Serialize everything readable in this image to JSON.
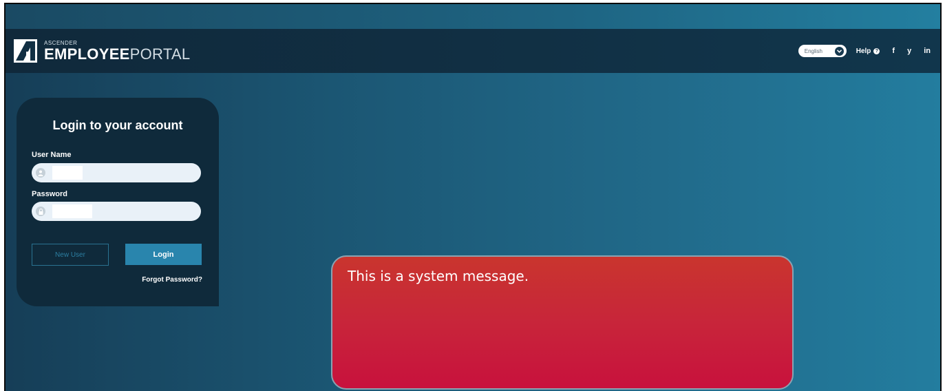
{
  "header": {
    "logo_small": "ASCENDER",
    "logo_bold": "EMPLOYEE",
    "logo_light": "PORTAL",
    "language_selected": "English",
    "help_label": "Help",
    "help_icon": "question-circle-icon",
    "social": [
      {
        "icon": "facebook-icon",
        "glyph": "f"
      },
      {
        "icon": "twitter-icon",
        "glyph": "y"
      },
      {
        "icon": "linkedin-icon",
        "glyph": "in"
      }
    ]
  },
  "login": {
    "title": "Login to your account",
    "username_label": "User Name",
    "username_icon": "user-icon",
    "password_label": "Password",
    "password_icon": "lock-icon",
    "new_user_label": "New User",
    "login_label": "Login",
    "forgot_label": "Forgot Password?"
  },
  "system_message": {
    "text": "This is a system message."
  },
  "colors": {
    "header_bg": "#112f43",
    "panel_bg": "#0f2a3b",
    "login_button": "#2985ad",
    "message_red": "#c8253a"
  }
}
